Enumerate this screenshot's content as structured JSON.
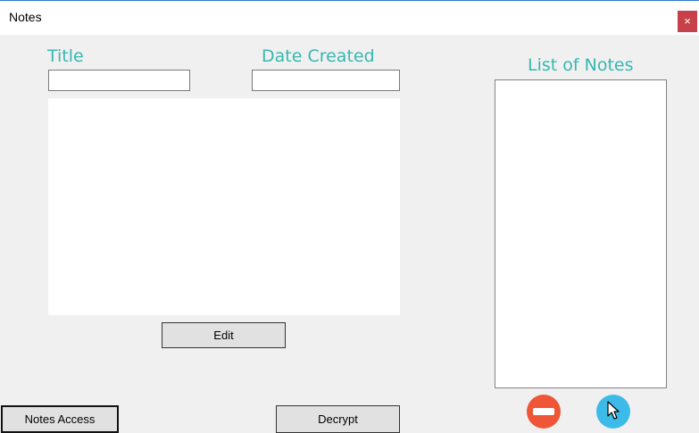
{
  "window": {
    "title": "Notes",
    "close_glyph": "×"
  },
  "form": {
    "title_label": "Title",
    "title_value": "",
    "date_label": "Date Created",
    "date_value": "",
    "body_value": ""
  },
  "buttons": {
    "edit": "Edit",
    "notes_access": "Notes Access",
    "decrypt": "Decrypt"
  },
  "notes_list": {
    "label": "List of Notes",
    "items": []
  },
  "icons": {
    "remove": "minus-circle-icon",
    "add": "plus-circle-icon",
    "cursor": "mouse-pointer-icon"
  },
  "colors": {
    "accent_label": "#36b8b0",
    "close_button": "#c7414a",
    "remove_button": "#ee5637",
    "add_button": "#3cbbe9",
    "window_border": "#2b78c6"
  }
}
